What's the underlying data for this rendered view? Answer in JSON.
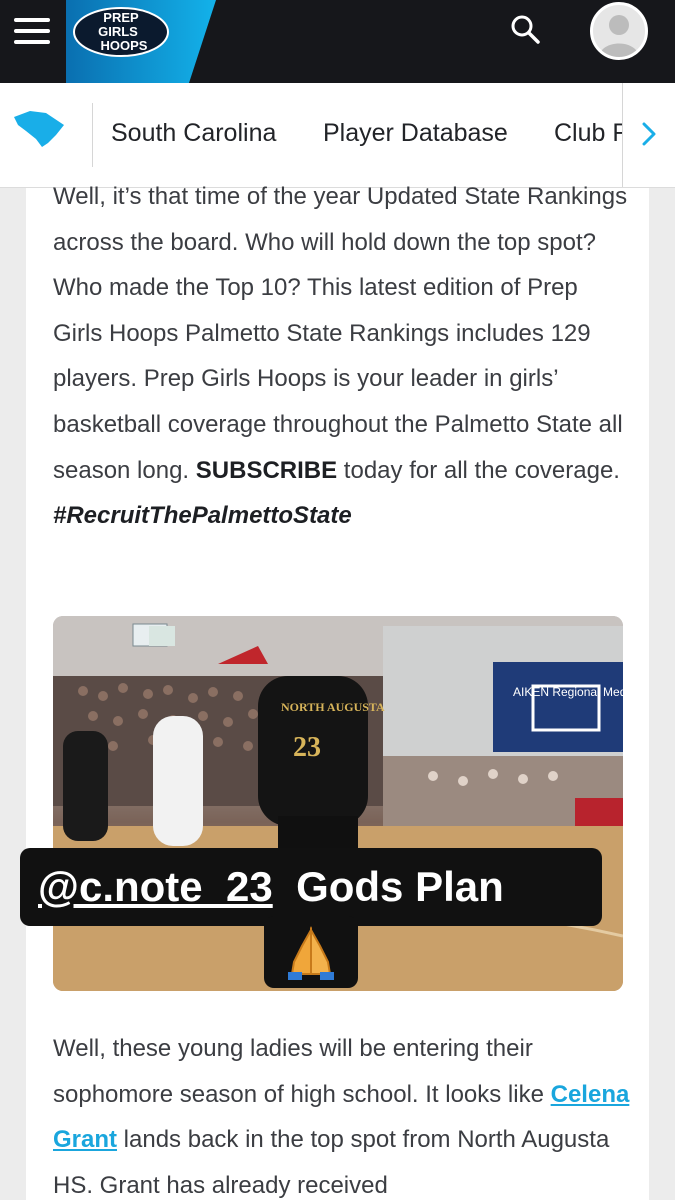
{
  "header": {
    "logo_lines": [
      "PREP",
      "GIRLS",
      "HOOPS"
    ],
    "brand_color": "#13b2ea",
    "icons": [
      "menu-icon",
      "search-icon",
      "user-avatar-icon"
    ]
  },
  "nav": {
    "state_icon": "south-carolina-map-icon",
    "items": [
      "South Carolina",
      "Player Database",
      "Club R"
    ],
    "next_icon": "chevron-right-icon"
  },
  "article": {
    "intro": "Well, it’s that time of the year Updated State Rankings across the board. Who will hold down the top spot? Who made the Top 10? This latest edition of Prep Girls Hoops Palmetto State Rankings includes 129 players. Prep Girls Hoops is your leader in girls’ basketball coverage throughout the Palmetto State all season long.",
    "subscribe": "SUBSCRIBE",
    "subscribe_rest": " today for all the coverage.",
    "hashtag": "#RecruitThePalmettoState",
    "image_sign_text": "AIKEN Regional Medical Centers",
    "jersey_text": "NORTH AUGUSTA",
    "jersey_number": "23",
    "caption_handle": "@c.note_23",
    "caption_text": "Gods Plan",
    "caption_emoji": "🙏",
    "para2_start": "Well, these young ladies will be entering their sophomore season of high school. It looks like ",
    "para2_link": "Celena Grant",
    "para2_end": " lands back in the top spot from North Augusta HS. Grant has already received"
  }
}
